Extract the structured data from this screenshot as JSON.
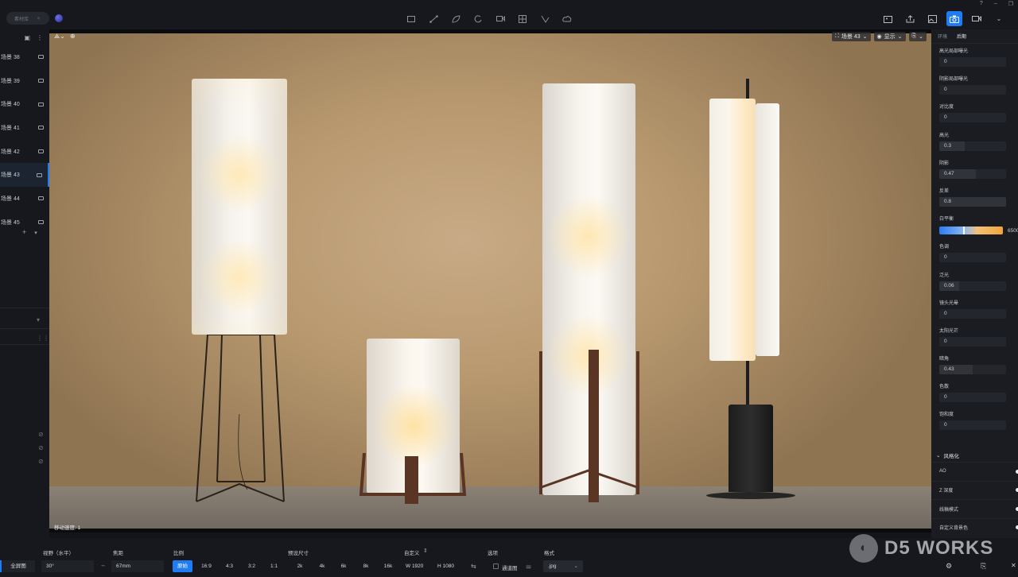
{
  "topbar": {
    "library_pill": "素材库",
    "center_tools": [
      "rectangle-icon",
      "line-icon",
      "leaf-icon",
      "rotate-icon",
      "camera-move-icon",
      "grid-icon",
      "path-icon",
      "cloud-icon"
    ],
    "right_tools": [
      "gallery-icon",
      "share-icon",
      "image-icon",
      "camera-icon",
      "video-icon",
      "chevron-down-icon"
    ]
  },
  "window": {
    "help": "?",
    "minimize": "–",
    "restore": "❐"
  },
  "scenes": {
    "items": [
      "场景 38",
      "场景 39",
      "场景 40",
      "场景 41",
      "场景 42",
      "场景 43",
      "场景 44",
      "场景 45"
    ],
    "active_index": 5,
    "add": "+"
  },
  "viewport": {
    "scene_select": "场景 43",
    "display": "显示",
    "speed": "移动速度: 1"
  },
  "right_panel": {
    "tabs": [
      "环境",
      "后期"
    ],
    "active_tab": "后期",
    "params": [
      {
        "label": "高光局部曝光",
        "value": "0",
        "fill": 0
      },
      {
        "label": "阴影局部曝光",
        "value": "0",
        "fill": 0
      },
      {
        "label": "对比度",
        "value": "0",
        "fill": 0
      },
      {
        "label": "高光",
        "value": "0.3",
        "fill": 0.38
      },
      {
        "label": "阴影",
        "value": "0.47",
        "fill": 0.55
      },
      {
        "label": "反差",
        "value": "0.8",
        "fill": 1.0
      },
      {
        "label": "白平衡",
        "value": "6500",
        "fill": 0.5
      },
      {
        "label": "色调",
        "value": "0",
        "fill": 0
      },
      {
        "label": "泛光",
        "value": "0.06",
        "fill": 0.3
      },
      {
        "label": "镜头光晕",
        "value": "0",
        "fill": 0
      },
      {
        "label": "太阳光芒",
        "value": "0",
        "fill": 0
      },
      {
        "label": "暗角",
        "value": "0.43",
        "fill": 0.5
      },
      {
        "label": "色散",
        "value": "0",
        "fill": 0
      },
      {
        "label": "饱和度",
        "value": "0",
        "fill": 0
      }
    ],
    "stylize": {
      "title": "风格化",
      "rows": [
        "AO",
        "Z 深度",
        "线稿模式",
        "自定义背景色"
      ]
    }
  },
  "bottom": {
    "fullscreen": "全屏图",
    "fov_label": "视野（水平）",
    "fov_value": "30°",
    "focal_label": "焦距",
    "focal_value": "67mm",
    "ratio_label": "比例",
    "ratios": [
      "原始",
      "16:9",
      "4:3",
      "3:2",
      "1:1"
    ],
    "ratio_active": 0,
    "preset_label": "预设尺寸",
    "presets": [
      "2k",
      "4k",
      "6k",
      "8k",
      "16k"
    ],
    "custom_label": "自定义",
    "width": "W  1920",
    "height": "H  1080",
    "options_label": "选项",
    "channel": "通道图",
    "format_label": "格式",
    "format_value": ".jpg"
  },
  "watermark": {
    "text": "D5 WORKS"
  }
}
